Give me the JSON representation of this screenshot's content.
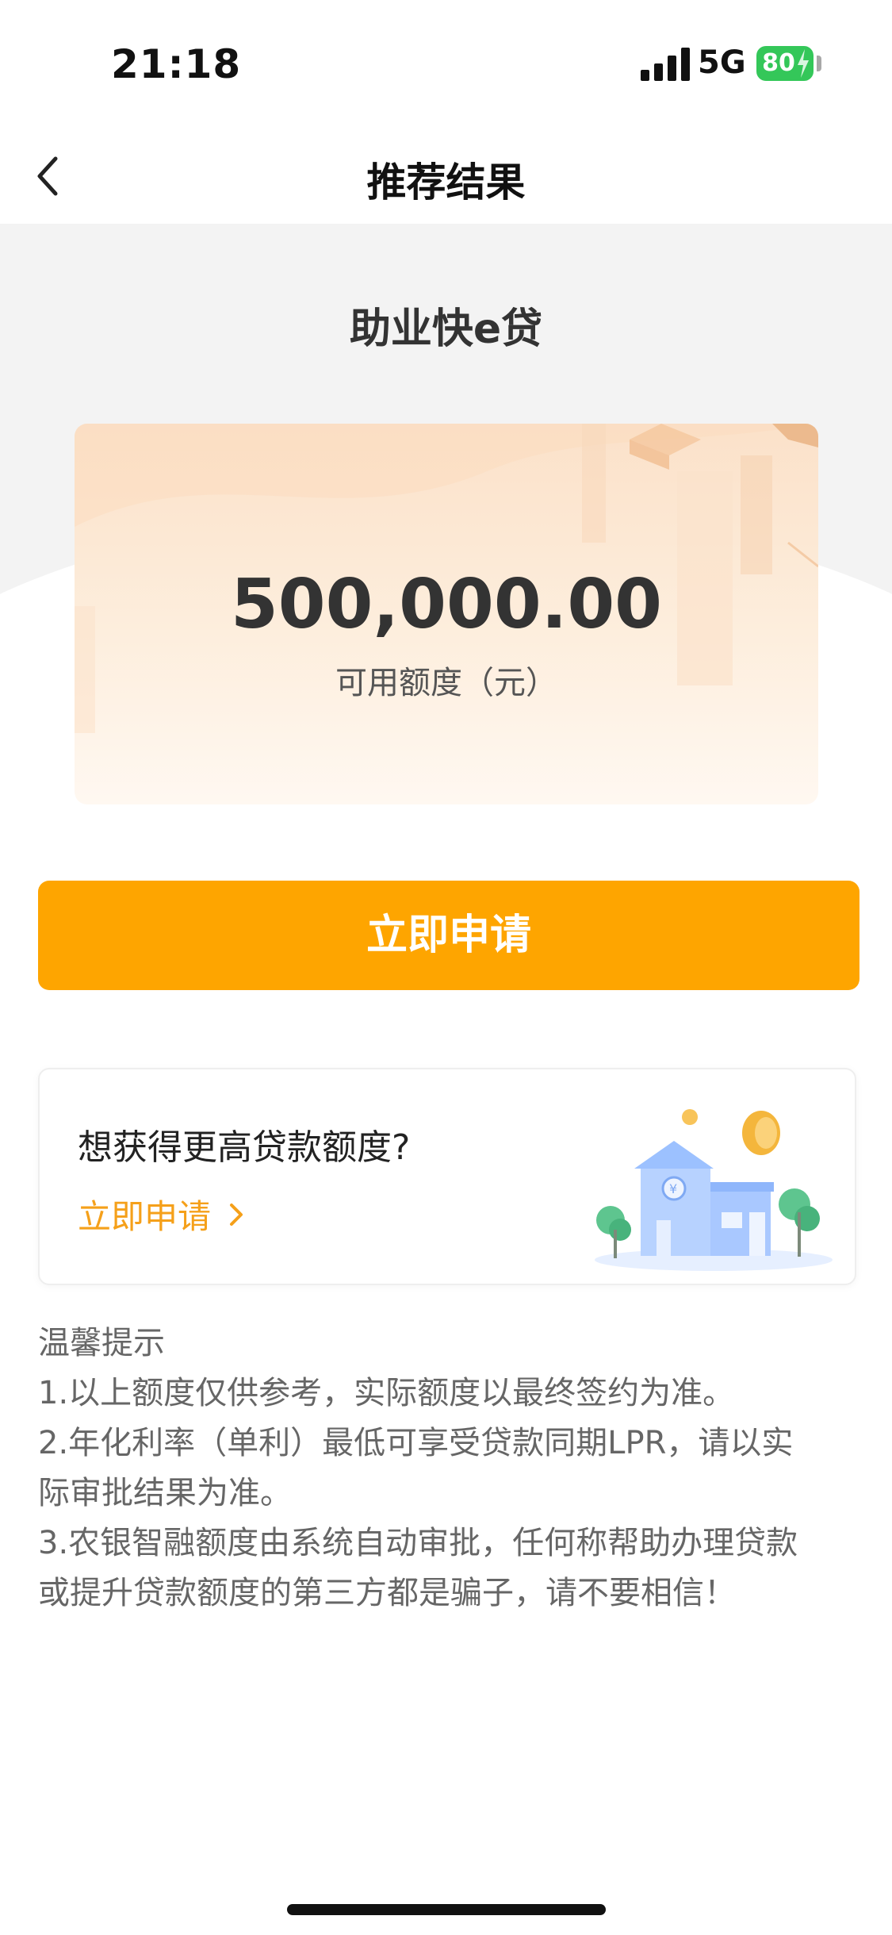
{
  "status_bar": {
    "time": "21:18",
    "network": "5G",
    "battery": "80"
  },
  "nav": {
    "title": "推荐结果",
    "back_icon": "chevron-left-icon"
  },
  "product": {
    "name": "助业快e贷"
  },
  "credit_card": {
    "amount": "500,000.00",
    "label": "可用额度（元）"
  },
  "apply_button": {
    "label": "立即申请"
  },
  "promo": {
    "title": "想获得更高贷款额度?",
    "link_label": "立即申请",
    "illustration": "bank-building-illustration"
  },
  "tips": {
    "title": "温馨提示",
    "lines": [
      "1.以上额度仅供参考，实际额度以最终签约为准。",
      "2.年化利率（单利）最低可享受贷款同期LPR，请以实",
      "际审批结果为准。",
      "3.农银智融额度由系统自动审批，任何称帮助办理贷款",
      "或提升贷款额度的第三方都是骗子，请不要相信！"
    ]
  },
  "colors": {
    "accent": "#fea500",
    "link": "#f5a01a",
    "battery": "#34c759"
  }
}
